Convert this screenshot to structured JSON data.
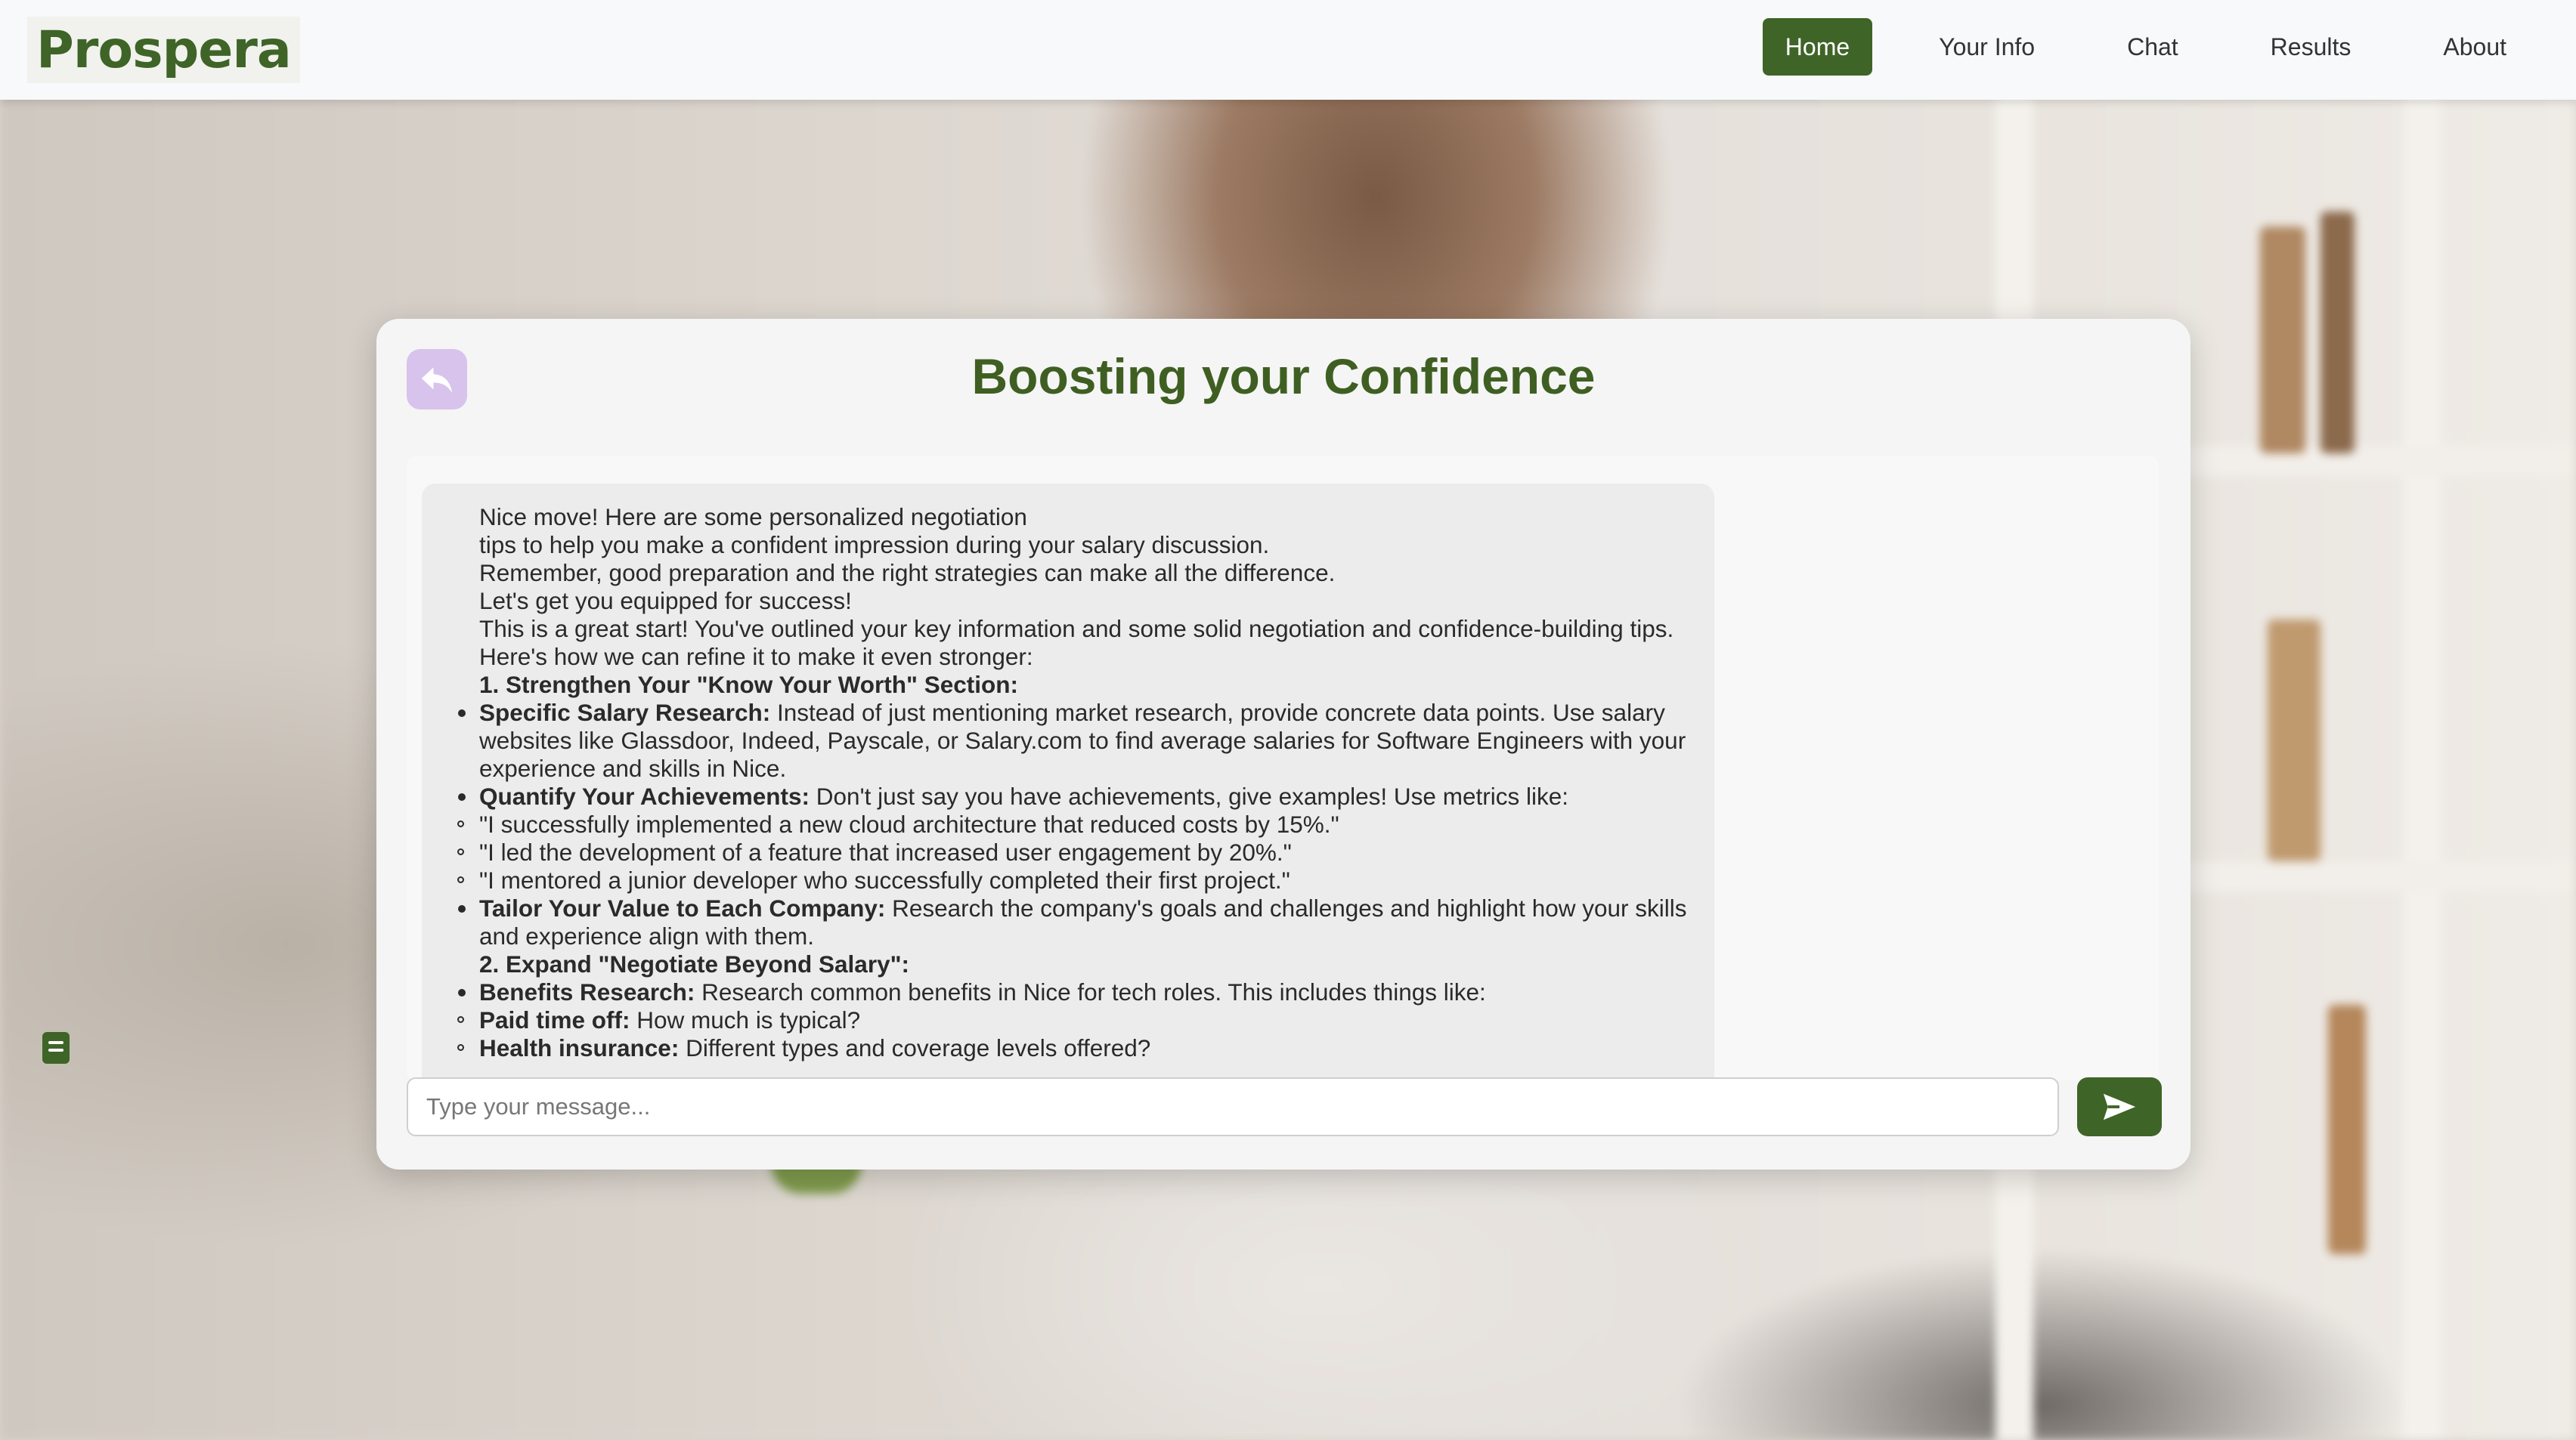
{
  "brand": {
    "name": "Prospera",
    "accent": "#3f6427",
    "title_color": "#3f5f22"
  },
  "nav": {
    "items": [
      {
        "label": "Home",
        "active": true
      },
      {
        "label": "Your Info",
        "active": false
      },
      {
        "label": "Chat",
        "active": false
      },
      {
        "label": "Results",
        "active": false
      },
      {
        "label": "About",
        "active": false
      }
    ]
  },
  "page": {
    "title": "Boosting your Confidence",
    "back_icon": "reply-arrow-icon",
    "back_button_color": "#d7c3ec"
  },
  "chat": {
    "message": {
      "intro": [
        "Nice move! Here are some personalized negotiation",
        "tips to help you make a confident impression during your salary discussion.",
        "Remember, good preparation and the right strategies can make all the difference.",
        "Let's get you equipped for success!",
        "This is a great start! You've outlined your key information and some solid negotiation and confidence-building tips.",
        "Here's how we can refine it to make it even stronger:"
      ],
      "section1_heading": "1. Strengthen Your \"Know Your Worth\" Section:",
      "item1_bold": "Specific Salary Research:",
      "item1_text": " Instead of just mentioning market research, provide concrete data points. Use salary websites like Glassdoor, Indeed, Payscale, or Salary.com to find average salaries for Software Engineers with your experience and skills in Nice.",
      "item2_bold": "Quantify Your Achievements:",
      "item2_text": " Don't just say you have achievements, give examples! Use metrics like:",
      "examples": [
        "\"I successfully implemented a new cloud architecture that reduced costs by 15%.\"",
        "\"I led the development of a feature that increased user engagement by 20%.\"",
        "\"I mentored a junior developer who successfully completed their first project.\""
      ],
      "item3_bold": "Tailor Your Value to Each Company:",
      "item3_text": " Research the company's goals and challenges and highlight how your skills and experience align with them.",
      "section2_heading": "2. Expand \"Negotiate Beyond Salary\":",
      "item4_bold": "Benefits Research:",
      "item4_text": " Research common benefits in Nice for tech roles. This includes things like:",
      "sub1_bold": "Paid time off:",
      "sub1_text": " How much is typical?",
      "sub2_bold": "Health insurance:",
      "sub2_text": " Different types and coverage levels offered?"
    },
    "input_placeholder": "Type your message...",
    "input_value": "",
    "send_icon": "send-arrow-icon",
    "doc_icon": "document-icon"
  }
}
